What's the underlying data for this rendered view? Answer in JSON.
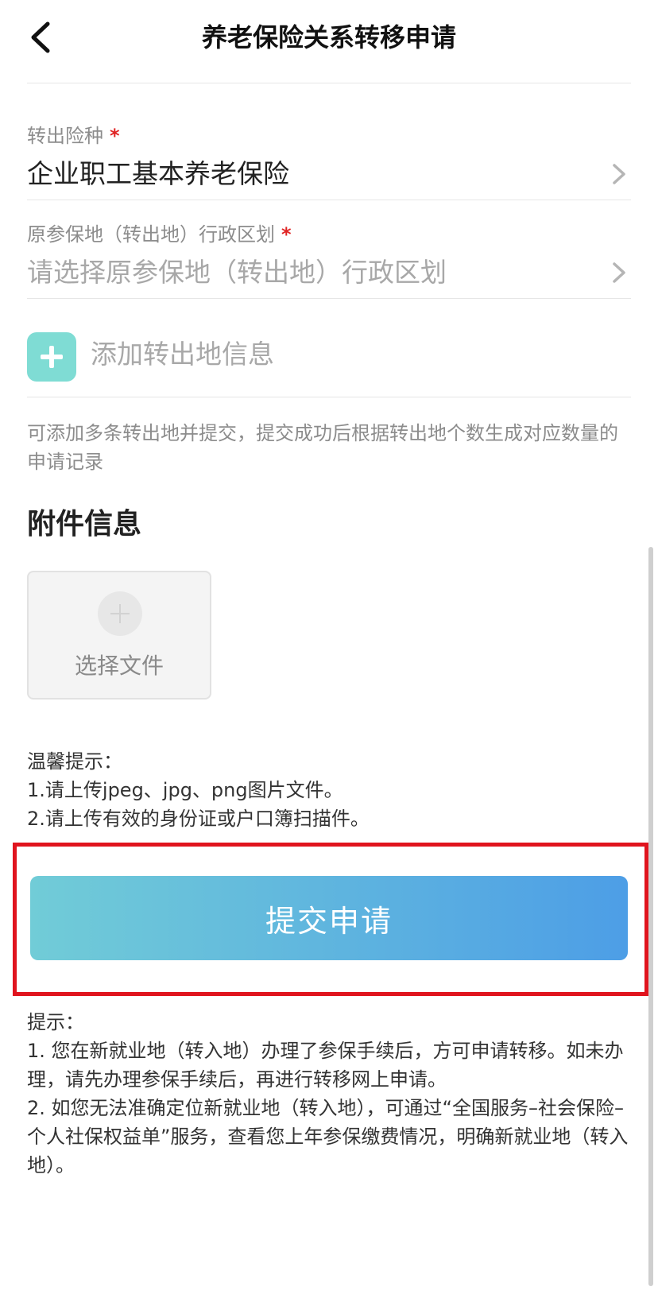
{
  "header": {
    "title": "养老保险关系转移申请",
    "back_icon": "chevron-left-icon"
  },
  "form": {
    "transfer_type": {
      "label": "转出险种",
      "required_mark": "*",
      "value": "企业职工基本养老保险"
    },
    "origin_region": {
      "label": "原参保地（转出地）行政区划",
      "required_mark": "*",
      "placeholder": "请选择原参保地（转出地）行政区划"
    },
    "add_origin": {
      "label": "添加转出地信息",
      "icon": "plus-icon"
    },
    "multi_hint": "可添加多条转出地并提交，提交成功后根据转出地个数生成对应数量的申请记录"
  },
  "attachments": {
    "title": "附件信息",
    "upload_label": "选择文件"
  },
  "warm_tips": {
    "title": "温馨提示：",
    "lines": [
      "1.请上传jpeg、jpg、png图片文件。",
      "2.请上传有效的身份证或户口簿扫描件。"
    ]
  },
  "submit": {
    "label": "提交申请"
  },
  "footer_tips": {
    "title": "提示：",
    "items": [
      "1. 您在新就业地（转入地）办理了参保手续后，方可申请转移。如未办理，请先办理参保手续后，再进行转移网上申请。",
      "2. 如您无法准确定位新就业地（转入地），可通过“全国服务–社会保险–个人社保权益单”服务，查看您上年参保缴费情况，明确新就业地（转入地）。"
    ]
  },
  "colors": {
    "accent_start": "#71ccd7",
    "accent_end": "#4d9ee6",
    "required": "#e02424",
    "highlight_border": "#e0141e",
    "add_icon_bg": "#7fdcd4"
  }
}
